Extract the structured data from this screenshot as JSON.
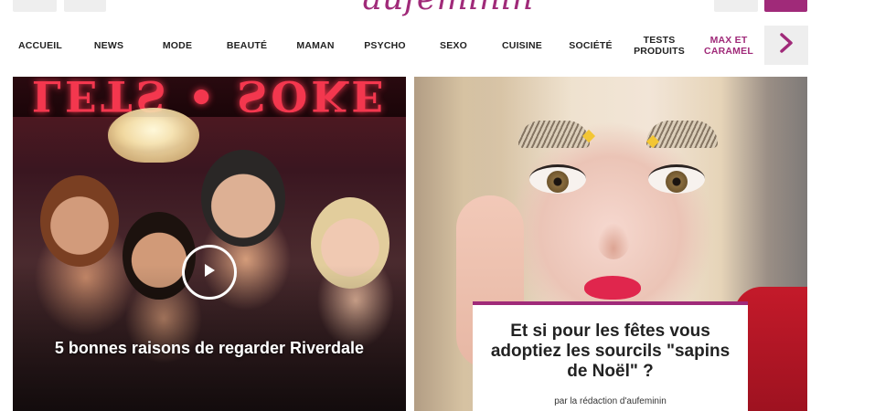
{
  "header": {
    "logo_text": "aufeminin"
  },
  "nav": {
    "items": [
      {
        "label": "ACCUEIL"
      },
      {
        "label": "NEWS"
      },
      {
        "label": "MODE"
      },
      {
        "label": "BEAUTÉ"
      },
      {
        "label": "MAMAN"
      },
      {
        "label": "PSYCHO"
      },
      {
        "label": "SEXO"
      },
      {
        "label": "CUISINE"
      },
      {
        "label": "SOCIÉTÉ"
      },
      {
        "label": "TESTS PRODUITS"
      },
      {
        "label": "MAX ET CARAMEL"
      }
    ],
    "next_icon": "chevron-right-icon"
  },
  "cards": [
    {
      "title": "5 bonnes raisons de regarder Riverdale",
      "media_icon": "play-icon",
      "sign_text": "LETS • SOKE"
    },
    {
      "title": "Et si pour les fêtes vous adoptiez les sourcils \"sapins de Noël\" ?",
      "author": "par la rédaction d'aufeminin"
    }
  ],
  "colors": {
    "brand": "#a02a79",
    "nav_text": "#222222"
  }
}
